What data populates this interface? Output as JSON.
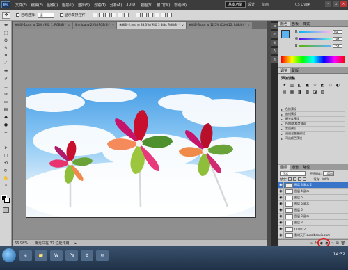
{
  "app": {
    "logo": "Ps",
    "menus": [
      "文件(F)",
      "编辑(E)",
      "图像(I)",
      "图层(L)",
      "选择(S)",
      "滤镜(T)",
      "分析(A)",
      "3D(D)",
      "视图(V)",
      "窗口(W)",
      "帮助(H)"
    ],
    "mini_tools": [
      "▤",
      "▢",
      "76%",
      "▾",
      "✋",
      "⌕",
      "▦",
      "▾"
    ],
    "workspaces": [
      "基本功能",
      "设计",
      "绘画"
    ],
    "cs_live": "CS Live▾"
  },
  "options_bar": {
    "auto_select_label": "自动选择:",
    "auto_select_value": "组",
    "transform_label": "显示变换控件"
  },
  "tabs": [
    {
      "label": "未标题-1.psd @ 50% (图层 1, RGB/8) *",
      "active": false
    },
    {
      "label": "风车.jpg @ 25% (RGB/8) *",
      "active": false
    },
    {
      "label": "未标题-2.psd @ 33.3% (图层 3 副本, RGB/8) *",
      "active": true
    },
    {
      "label": "未标题-3.psd @ 12.5% (CU0822, RGB/8) *",
      "active": false
    }
  ],
  "status": {
    "zoom": "66.98%",
    "info": "曝光只在 32 位起作用"
  },
  "color_panel": {
    "tabs": [
      "颜色",
      "色板",
      "样式"
    ],
    "channels": [
      {
        "label": "R",
        "value": "89",
        "track": "linear-gradient(90deg,#00b3f0,#ffb3f0)"
      },
      {
        "label": "G",
        "value": "184",
        "track": "linear-gradient(90deg,#5a00f0,#5affe0)"
      },
      {
        "label": "B",
        "value": "254",
        "track": "linear-gradient(90deg,#5ab300,#5ab3ff)"
      }
    ]
  },
  "adjustments_panel": {
    "tabs": [
      "调整",
      "蒙版"
    ],
    "title": "添加调整",
    "icons": [
      "☀",
      "▥",
      "◧",
      "▣",
      "▽",
      "◩",
      "⚖",
      "◐",
      "▤",
      "▦",
      "◨",
      "▩",
      "◪",
      "▧"
    ],
    "presets": [
      "色阶预设",
      "曲线预设",
      "曝光度预设",
      "色相/饱和度预设",
      "黑白预设",
      "通道混合器预设",
      "可选颜色预设"
    ]
  },
  "layers_panel": {
    "tabs": [
      "图层",
      "通道",
      "路径"
    ],
    "blend_mode": "正常",
    "opacity_label": "不透明度:",
    "opacity_value": "100%",
    "lock_label": "锁定:",
    "fill_label": "填充:",
    "fill_value": "100%",
    "layers": [
      {
        "name": "图层 3 副本 2",
        "selected": true
      },
      {
        "name": "图层 4 副本",
        "selected": false
      },
      {
        "name": "图层 6",
        "selected": false
      },
      {
        "name": "图层 6 副本",
        "selected": false
      },
      {
        "name": "图层 5",
        "selected": false
      },
      {
        "name": "图层 3 副本",
        "selected": false
      },
      {
        "name": "图层 3",
        "selected": false
      },
      {
        "name": "CU0822",
        "selected": false
      },
      {
        "name": "素材天下 sucaitianxia.com",
        "selected": false
      },
      {
        "name": "素材天下 sucaitianxia.com",
        "selected": false
      },
      {
        "name": "素材天下 sucaitianxia.com",
        "selected": false
      }
    ],
    "footer_icons": [
      "∞",
      "fx",
      "◐",
      "◓",
      "▭",
      "⊞",
      "🗑"
    ]
  },
  "taskbar": {
    "items": [
      "e",
      "📁",
      "W",
      "Ps",
      "⚙",
      "✉"
    ],
    "clock": "14:32"
  },
  "colors": {
    "accent": "#3874c7",
    "highlight_circle": "#e51c1c",
    "fg_color": "#5ab3f0"
  }
}
